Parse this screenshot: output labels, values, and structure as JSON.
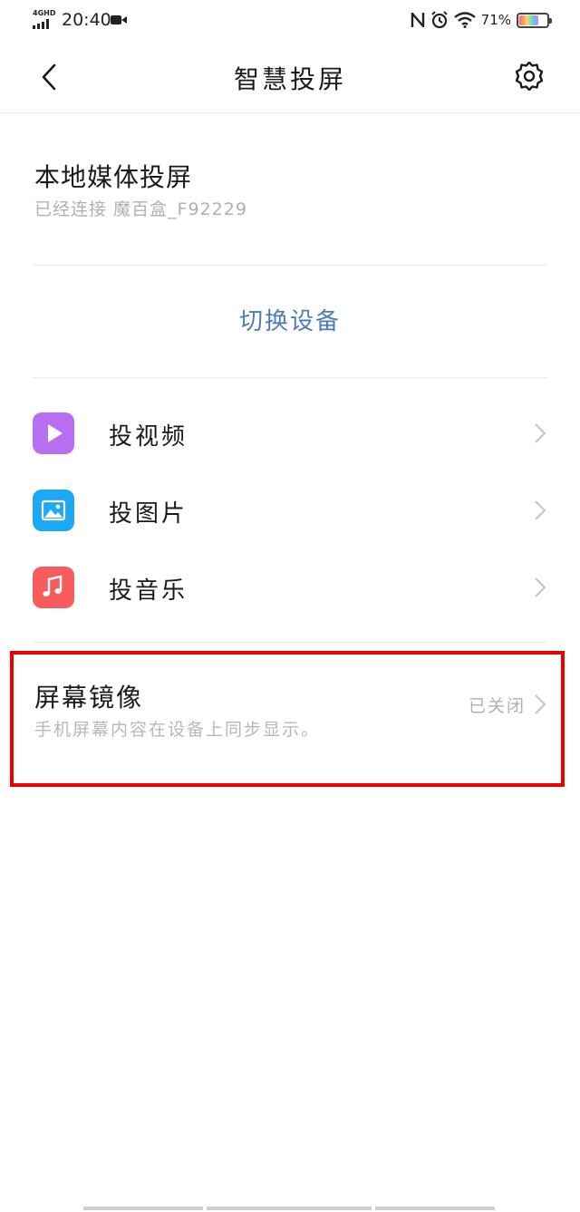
{
  "status_bar": {
    "network": "4GHD",
    "time": "20:40",
    "battery_percent": "71%",
    "battery_level": 0.71
  },
  "header": {
    "title": "智慧投屏"
  },
  "local_cast": {
    "title": "本地媒体投屏",
    "subtitle": "已经连接 魔百盒_F92229"
  },
  "switch_device_label": "切换设备",
  "cast_items": [
    {
      "label": "投视频",
      "icon": "play-icon",
      "color": "#b86ef0"
    },
    {
      "label": "投图片",
      "icon": "image-icon",
      "color": "#1ca8f2"
    },
    {
      "label": "投音乐",
      "icon": "music-note-icon",
      "color": "#f75c5c"
    }
  ],
  "screen_mirror": {
    "title": "屏幕镜像",
    "subtitle": "手机屏幕内容在设备上同步显示。",
    "status": "已关闭",
    "highlight_color": "#ee0000"
  },
  "colors": {
    "accent_link": "#4a7dc0",
    "secondary_text": "#b0b0b0"
  }
}
